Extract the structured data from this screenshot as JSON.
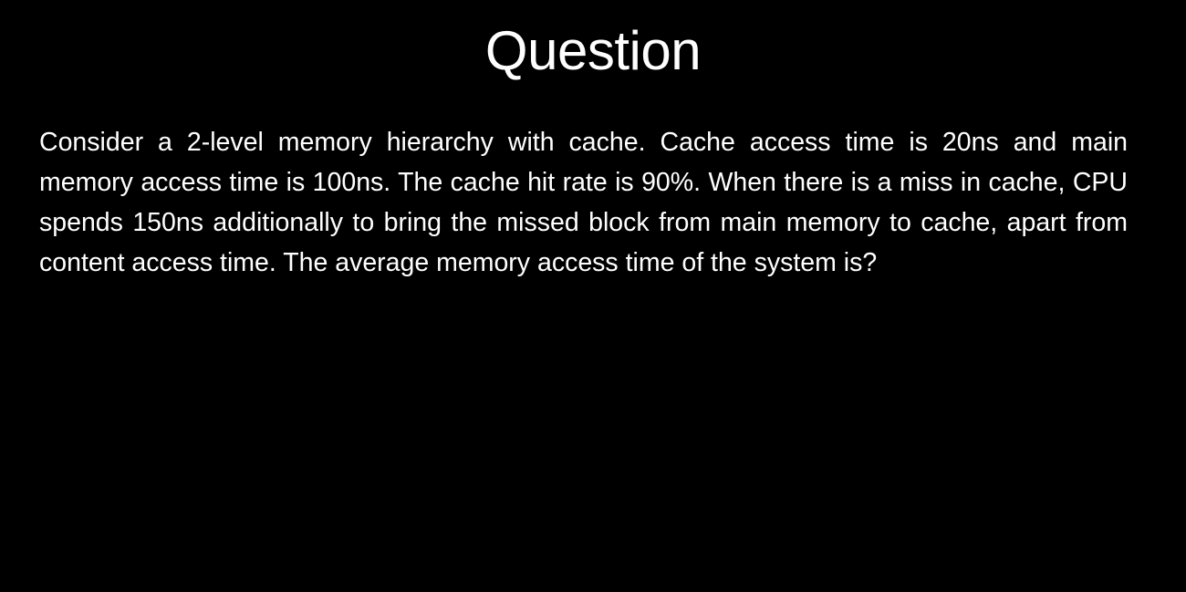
{
  "slide": {
    "title": "Question",
    "body": "Consider a 2-level memory hierarchy with cache. Cache access time is 20ns and main memory access time is 100ns. The cache hit rate is 90%. When there is a miss in cache, CPU spends 150ns additionally to bring the missed block from main memory to cache, apart from content access time. The average memory access time of the system is?",
    "background_color": "#000000",
    "text_color": "#ffffff"
  }
}
